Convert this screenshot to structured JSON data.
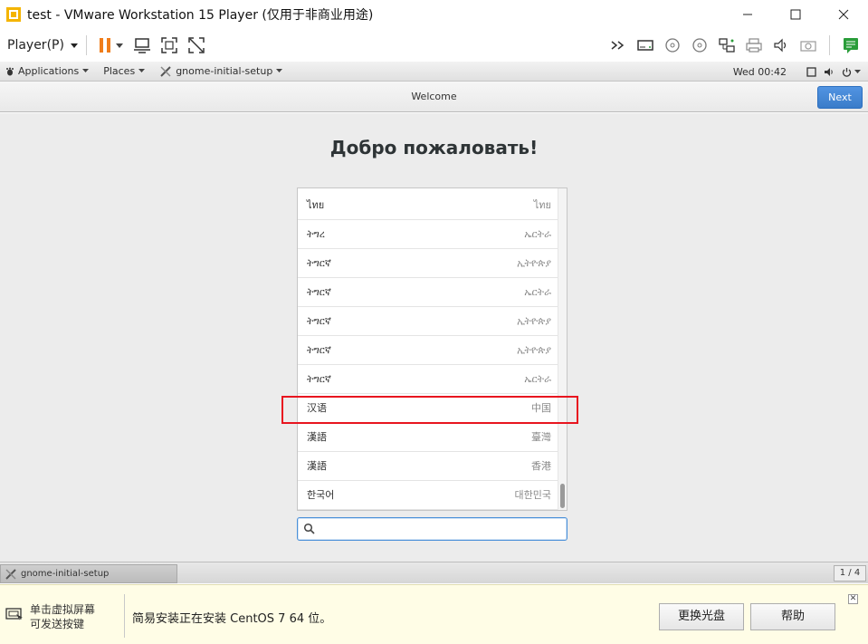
{
  "window": {
    "title": "test - VMware Workstation 15 Player (仅用于非商业用途)"
  },
  "vmtoolbar": {
    "player_menu": "Player(P)"
  },
  "gnome": {
    "applications": "Applications",
    "places": "Places",
    "app_name": "gnome-initial-setup",
    "clock": "Wed 00:42"
  },
  "header": {
    "title": "Welcome",
    "next": "Next"
  },
  "main": {
    "welcome": "Добро пожаловать!",
    "languages": [
      {
        "name": "ไทย",
        "region": "ไทย"
      },
      {
        "name": "ትግረ",
        "region": "ኤርትራ"
      },
      {
        "name": "ትግርኛ",
        "region": "ኢትዮጵያ"
      },
      {
        "name": "ትግርኛ",
        "region": "ኤርትራ"
      },
      {
        "name": "ትግርኛ",
        "region": "ኢትዮጵያ"
      },
      {
        "name": "ትግርኛ",
        "region": "ኢትዮጵያ"
      },
      {
        "name": "ትግርኛ",
        "region": "ኤርትራ"
      },
      {
        "name": "汉语",
        "region": "中国"
      },
      {
        "name": "漢語",
        "region": "臺灣"
      },
      {
        "name": "漢語",
        "region": "香港"
      },
      {
        "name": "한국어",
        "region": "대한민국"
      }
    ],
    "search_placeholder": ""
  },
  "taskbar": {
    "task": "gnome-initial-setup",
    "pager": "1 / 4"
  },
  "hint": {
    "left_line1": "单击虚拟屏幕",
    "left_line2": "可发送按键",
    "message": "简易安装正在安装 CentOS 7 64 位。",
    "change_disc": "更换光盘",
    "help": "帮助"
  }
}
